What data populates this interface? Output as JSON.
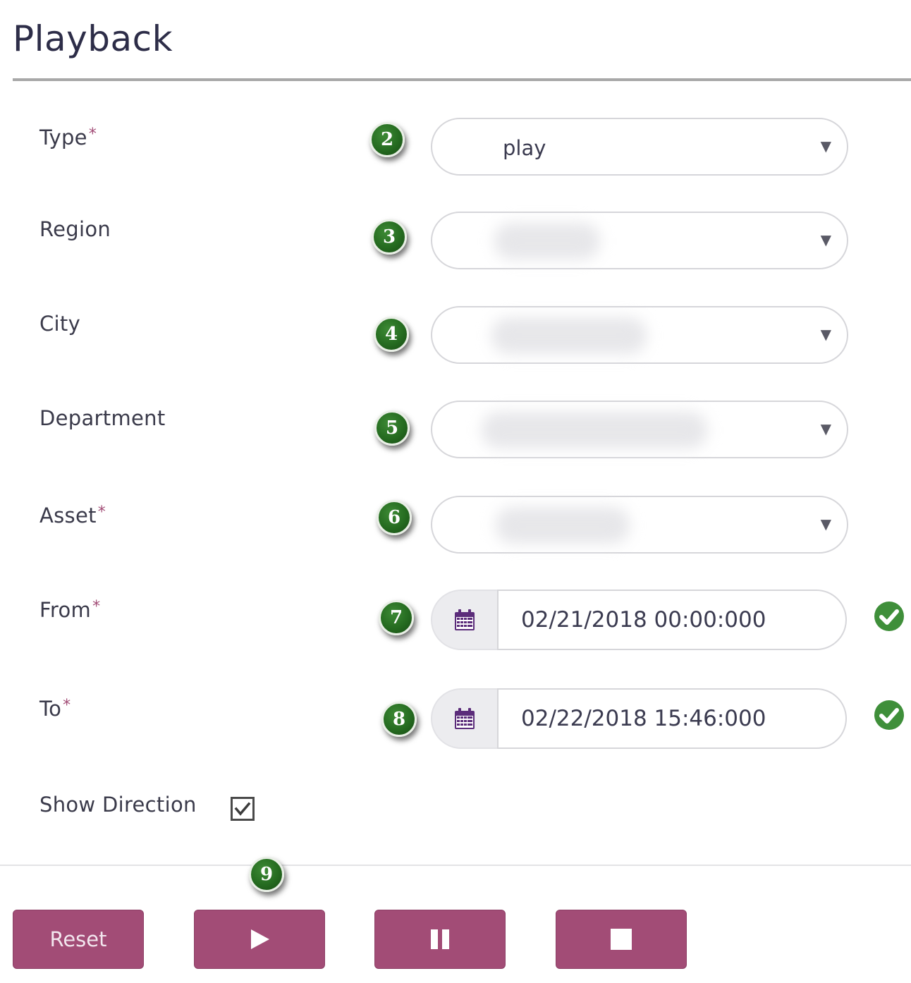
{
  "header": {
    "title": "Playback"
  },
  "form": {
    "required_mark": "*",
    "type": {
      "label": "Type",
      "value": "play",
      "badge": "2"
    },
    "region": {
      "label": "Region",
      "value": "",
      "badge": "3"
    },
    "city": {
      "label": "City",
      "value": "",
      "badge": "4"
    },
    "department": {
      "label": "Department",
      "value": "",
      "badge": "5"
    },
    "asset": {
      "label": "Asset",
      "value": "",
      "badge": "6"
    },
    "from": {
      "label": "From",
      "value": "02/21/2018 00:00:000",
      "badge": "7"
    },
    "to": {
      "label": "To",
      "value": "02/22/2018 15:46:000",
      "badge": "8"
    },
    "show_direction": {
      "label": "Show Direction",
      "checked": true
    }
  },
  "controls": {
    "badge": "9",
    "reset_label": "Reset",
    "play_icon": "play-icon",
    "pause_icon": "pause-icon",
    "stop_icon": "stop-icon"
  },
  "colors": {
    "accent": "#a24c76",
    "badge_green": "#256b20",
    "valid_green": "#3f8f3a",
    "calendar_purple": "#5b2c7a"
  }
}
